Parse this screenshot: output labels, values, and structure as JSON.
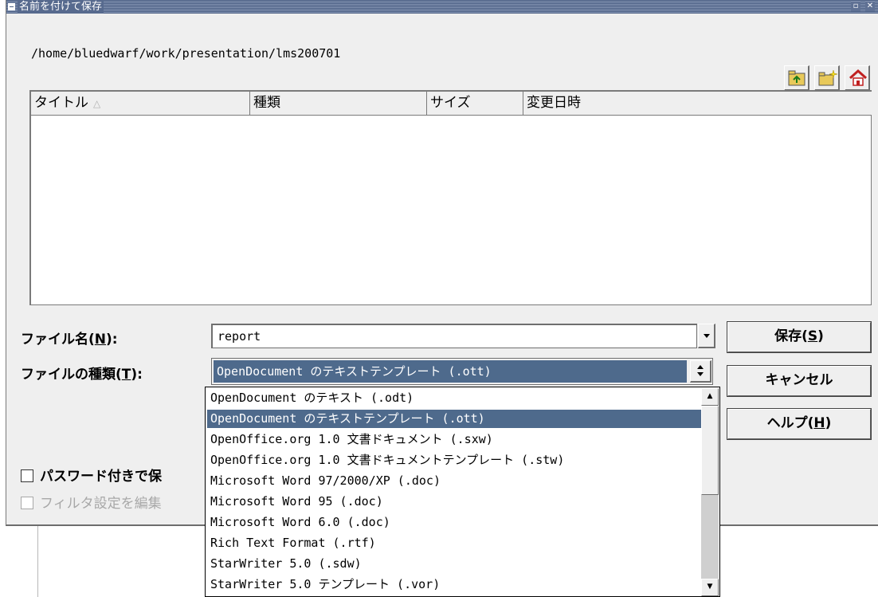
{
  "dialog": {
    "title": "名前を付けて保存",
    "path": "/home/bluedwarf/work/presentation/lms200701"
  },
  "toolbar": {
    "icons": [
      "up-folder-icon",
      "new-folder-icon",
      "home-icon"
    ]
  },
  "filelist": {
    "columns": [
      "タイトル",
      "種類",
      "サイズ",
      "変更日時"
    ],
    "sort_indicator": "△"
  },
  "filename": {
    "label_pre": "ファイル名(",
    "label_key": "N",
    "label_post": "):",
    "value": "report"
  },
  "filetype": {
    "label_pre": "ファイルの種類(",
    "label_key": "T",
    "label_post": "):",
    "selected": "OpenDocument のテキストテンプレート (.ott)",
    "options": [
      "OpenDocument のテキスト (.odt)",
      "OpenDocument のテキストテンプレート (.ott)",
      "OpenOffice.org 1.0 文書ドキュメント (.sxw)",
      "OpenOffice.org 1.0 文書ドキュメントテンプレート (.stw)",
      "Microsoft Word 97/2000/XP (.doc)",
      "Microsoft Word 95 (.doc)",
      "Microsoft Word 6.0 (.doc)",
      "Rich Text Format (.rtf)",
      "StarWriter 5.0 (.sdw)",
      "StarWriter 5.0 テンプレート (.vor)"
    ],
    "selected_index": 1
  },
  "buttons": {
    "save_pre": "保存(",
    "save_key": "S",
    "save_post": ")",
    "cancel": "キャンセル",
    "help_pre": "ヘルプ(",
    "help_key": "H",
    "help_post": ")"
  },
  "options": {
    "password": "パスワード付きで保",
    "filter": "フィルタ設定を編集"
  },
  "colors": {
    "selection": "#4e6a8c",
    "titlebar": "#4a5e83"
  }
}
